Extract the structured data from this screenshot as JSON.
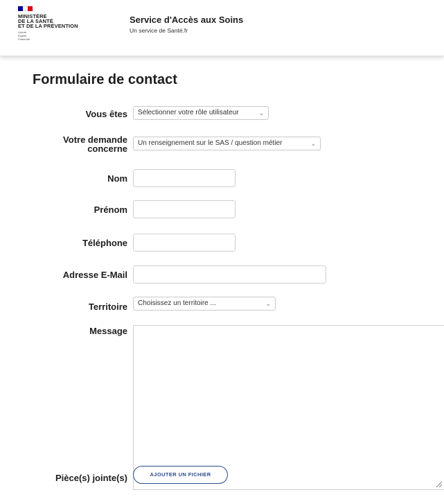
{
  "header": {
    "ministry_lines": [
      "MINISTÈRE",
      "DE LA SANTÉ",
      "ET DE LA PRÉVENTION"
    ],
    "motto_lines": [
      "Liberté",
      "Égalité",
      "Fraternité"
    ],
    "site_title": "Service d'Accès aux Soins",
    "site_subtitle": "Un service de Santé.fr",
    "flag_colors": [
      "#000091",
      "#ffffff",
      "#e1000f"
    ]
  },
  "form": {
    "title": "Formulaire de contact",
    "fields": {
      "role": {
        "label": "Vous êtes",
        "value": "Sélectionner votre rôle utilisateur"
      },
      "demande": {
        "label_line1": "Votre demande",
        "label_line2": "concerne",
        "value": "Un renseignement sur le SAS / question métier"
      },
      "nom": {
        "label": "Nom",
        "value": ""
      },
      "prenom": {
        "label": "Prénom",
        "value": ""
      },
      "telephone": {
        "label": "Téléphone",
        "value": ""
      },
      "email": {
        "label": "Adresse E-Mail",
        "value": ""
      },
      "territoire": {
        "label": "Territoire",
        "value": "Choisissez un territoire ..."
      },
      "message": {
        "label": "Message",
        "value": ""
      },
      "attachments": {
        "label": "Pièce(s) jointe(s)",
        "button_label": "AJOUTER UN FICHIER"
      }
    }
  },
  "colors": {
    "accent": "#2d4a8a",
    "border": "#cfcfcf"
  }
}
